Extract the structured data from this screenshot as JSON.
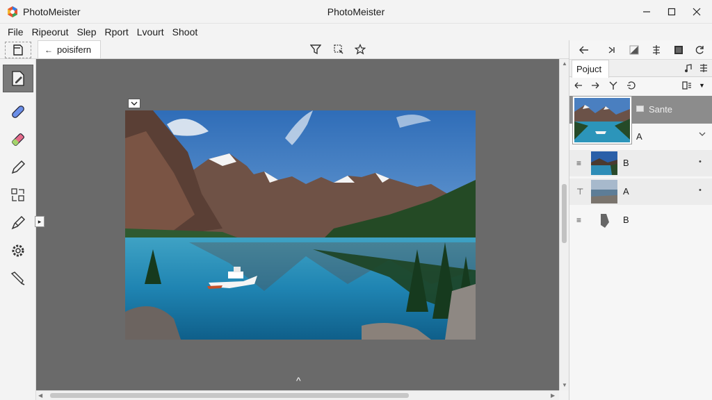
{
  "app": {
    "name": "PhotoMeister",
    "window_title": "PhotoMeister"
  },
  "window_controls": [
    "minimize-icon",
    "maximize-icon",
    "close-icon"
  ],
  "menu": [
    "File",
    "Ripeorut",
    "Slep",
    "Rport",
    "Lvourt",
    "Shoot"
  ],
  "toolbar": {
    "tab_label": "poisifern",
    "tab_arrow": "←",
    "icons": [
      "new-document-icon",
      "filter-funnel-icon",
      "select-region-icon",
      "star-icon"
    ]
  },
  "left_tools": [
    "document-edit-icon",
    "bandage-icon",
    "eraser-icon",
    "pencil-icon",
    "transform-icon",
    "brush-icon",
    "settings-gear-icon",
    "clone-tool-icon"
  ],
  "canvas": {
    "bottom_caret": "^",
    "side_handle": "▸"
  },
  "panel": {
    "tab": "Pojuct",
    "selected_layer": {
      "name": "Sante",
      "sub": "A"
    },
    "layers": [
      {
        "name": "B",
        "handle": "≡",
        "indicator": "•"
      },
      {
        "name": "A",
        "handle": "⊤",
        "indicator": "•"
      },
      {
        "name": "B",
        "handle": "≡",
        "indicator": ""
      }
    ]
  },
  "colors": {
    "canvas_bg": "#6a6a6a",
    "panel_selected": "#8c8c8c",
    "chrome": "#f3f3f3"
  }
}
